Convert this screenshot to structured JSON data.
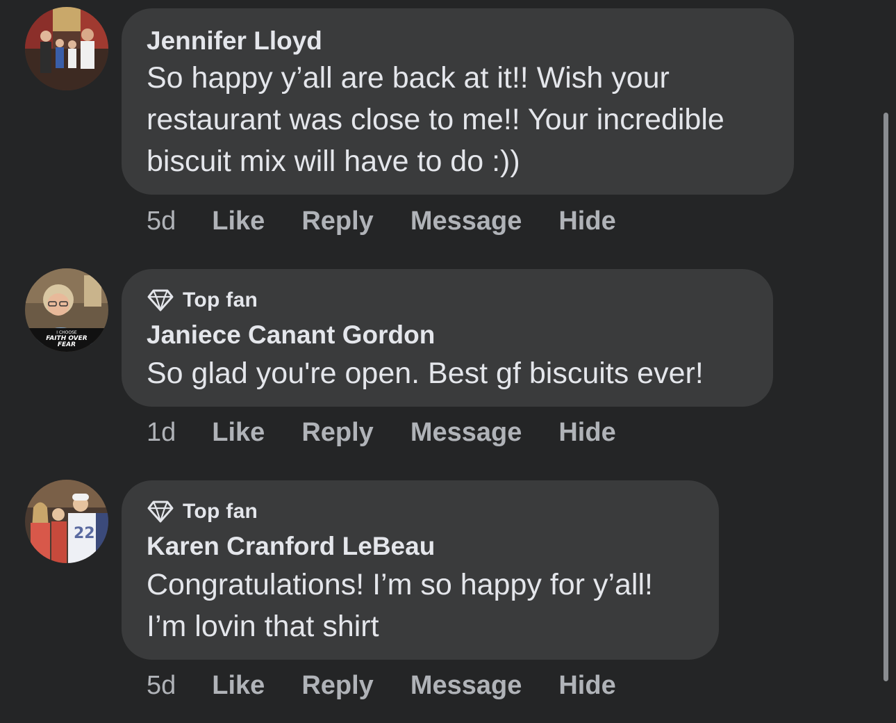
{
  "comments": [
    {
      "author": "Jennifer Lloyd",
      "top_fan": false,
      "text": "So happy y’all are back at it!! Wish your\nrestaurant was close to me!! Your incredible\nbiscuit mix will have to do :))",
      "time": "5d",
      "actions": {
        "like": "Like",
        "reply": "Reply",
        "message": "Message",
        "hide": "Hide"
      }
    },
    {
      "author": "Janiece Canant Gordon",
      "top_fan": true,
      "badge_label": "Top fan",
      "avatar_caption": {
        "line1": "I CHOOSE",
        "line2": "FAITH OVER",
        "line3": "FEAR"
      },
      "text": "So glad you're open. Best gf biscuits ever!",
      "time": "1d",
      "actions": {
        "like": "Like",
        "reply": "Reply",
        "message": "Message",
        "hide": "Hide"
      }
    },
    {
      "author": "Karen Cranford LeBeau",
      "top_fan": true,
      "badge_label": "Top fan",
      "text": "Congratulations! I’m so happy for y’all!\nI’m lovin that shirt",
      "time": "5d",
      "actions": {
        "like": "Like",
        "reply": "Reply",
        "message": "Message",
        "hide": "Hide"
      }
    }
  ],
  "icons": {
    "badge": "diamond-icon"
  },
  "colors": {
    "background": "#242526",
    "bubble": "#3a3b3c",
    "primary_text": "#e4e6eb",
    "secondary_text": "#b0b3b8"
  }
}
